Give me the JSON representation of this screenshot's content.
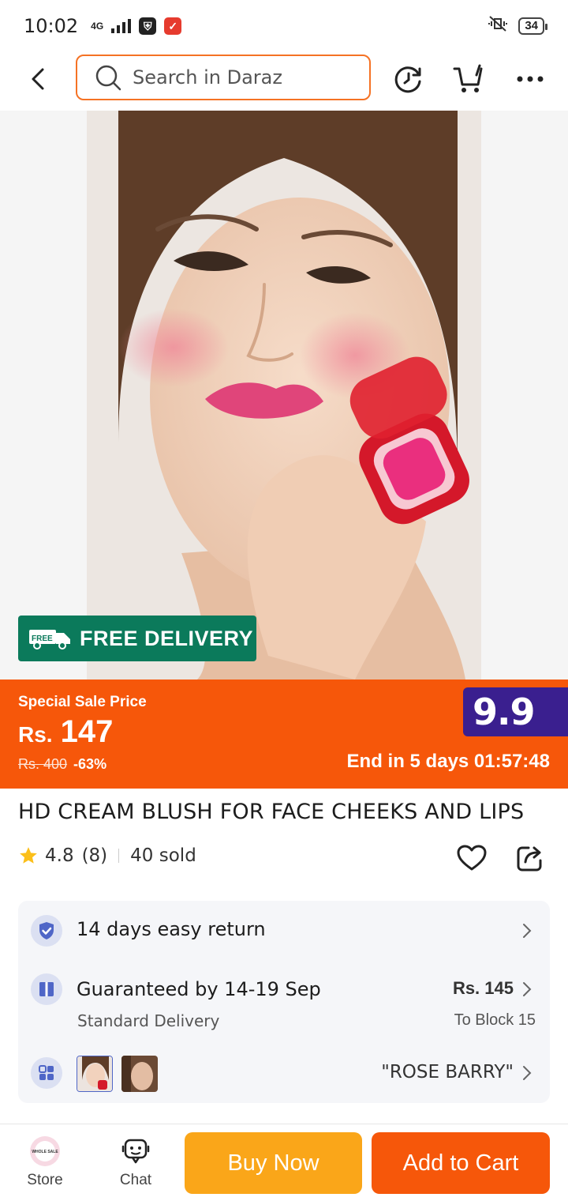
{
  "status_bar": {
    "time": "10:02",
    "network": "4G",
    "battery": "34"
  },
  "header": {
    "search_placeholder": "Search in Daraz"
  },
  "promo": {
    "free_delivery_badge": "FREE",
    "free_delivery": "FREE DELIVERY"
  },
  "price": {
    "sale_label": "Special Sale Price",
    "currency": "Rs.",
    "value": "147",
    "original": "Rs. 400",
    "discount": "-63%",
    "campaign_badge": "9.9",
    "countdown": "End in 5 days 01:57:48"
  },
  "product": {
    "title": "HD CREAM BLUSH FOR FACE CHEEKS AND LIPS",
    "rating": "4.8",
    "review_count": "(8)",
    "sold": "40 sold"
  },
  "info": {
    "return_policy": "14 days easy return",
    "delivery_guarantee": "Guaranteed by 14-19 Sep",
    "delivery_type": "Standard Delivery",
    "delivery_price": "Rs. 145",
    "delivery_location": "To Block 15",
    "variant_name": "\"ROSE BARRY\""
  },
  "bottom_bar": {
    "store_label": "Store",
    "store_logo_text": "WHOLE SALE",
    "chat_label": "Chat",
    "buy_now": "Buy Now",
    "add_to_cart": "Add to Cart"
  },
  "colors": {
    "brand_orange": "#f6570a",
    "buy_now_yellow": "#faa619",
    "free_delivery_green": "#0b7a5b",
    "campaign_purple": "#3a1f8f"
  }
}
